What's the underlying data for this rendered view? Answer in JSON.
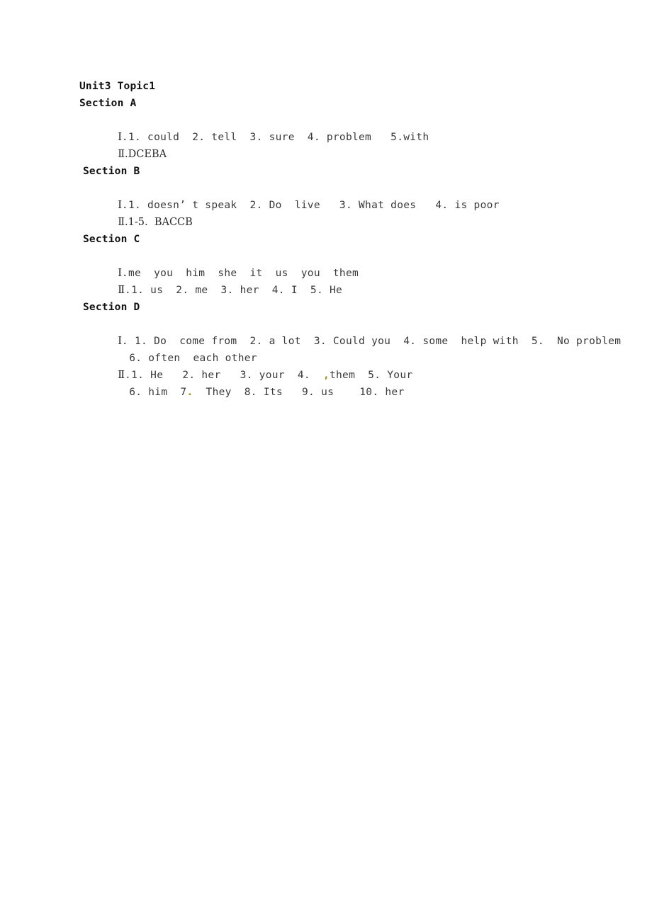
{
  "document": {
    "title": "Unit3 Topic1",
    "sections": [
      {
        "heading": "Section A",
        "lines": [
          {
            "numeral": "Ⅰ",
            "text": ".1. could  2. tell  3. sure  4. problem   5.with"
          },
          {
            "numeral": "Ⅱ",
            "text": ".DCEBA"
          }
        ]
      },
      {
        "heading": "Section B",
        "lines": [
          {
            "numeral": "Ⅰ",
            "text": ".1. doesn’ t speak  2. Do  live   3. What does   4. is poor"
          },
          {
            "numeral": "Ⅱ",
            "text": ".1-5.  BACCB"
          }
        ]
      },
      {
        "heading": "Section C",
        "lines": [
          {
            "numeral": "Ⅰ",
            "text": ".me  you  him  she  it  us  you  them"
          },
          {
            "numeral": "Ⅱ",
            "text": ".1. us  2. me  3. her  4. I  5. He"
          }
        ]
      },
      {
        "heading": "Section D",
        "lines": [
          {
            "numeral": "Ⅰ",
            "text": ". 1. Do  come from  2. a lot  3. Could you  4. some  help with  5.  No problem"
          },
          {
            "continuation": "6. often  each other"
          },
          {
            "numeral": "Ⅱ",
            "text": ".1. He   2. her   3. your  4.  ",
            "mark": ",",
            "text_after": "them  5. Your"
          },
          {
            "continuation_pre": "6. him  7",
            "mark": ".",
            "continuation_post": "  They  8. Its   9. us    10. her"
          }
        ]
      }
    ]
  },
  "colors": {
    "page_background": "#ffffff",
    "text": "#1a1a1a",
    "content_text": "#3a3a3a",
    "artifact_mark": "#9a8f1a"
  }
}
